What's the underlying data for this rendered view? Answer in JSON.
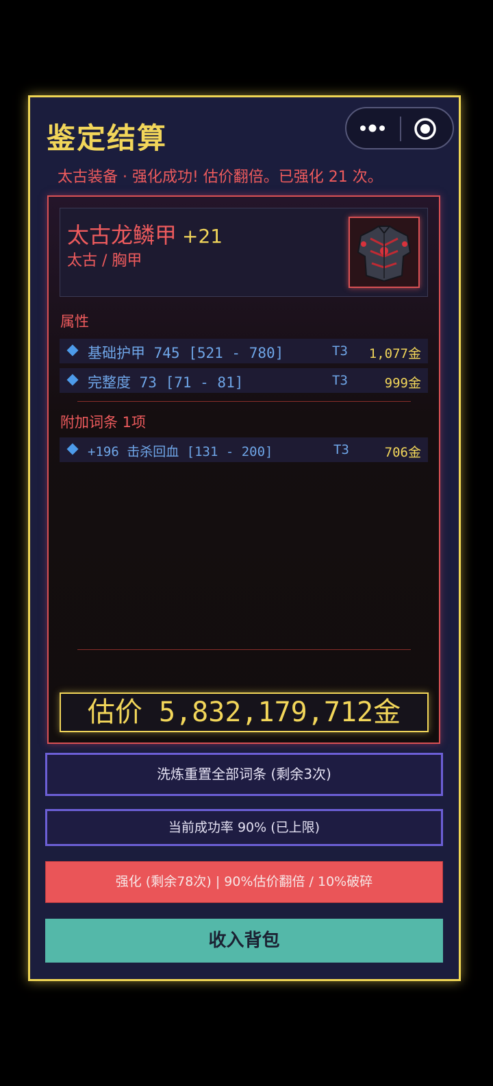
{
  "header": {
    "title": "鉴定结算",
    "subtitle": "太古装备 · 强化成功! 估价翻倍。已强化 21 次。"
  },
  "item": {
    "name": "太古龙鳞甲",
    "level": "+21",
    "type": "太古 / 胸甲",
    "icon": "armor-chestplate-icon"
  },
  "attributes": {
    "label": "属性",
    "rows": [
      {
        "stat": "基础护甲 745 [521 - 780]",
        "tier": "T3",
        "gold": "1,077金"
      },
      {
        "stat": "完整度 73 [71 - 81]",
        "tier": "T3",
        "gold": "999金"
      }
    ]
  },
  "affixes": {
    "label": "附加词条 1项",
    "rows": [
      {
        "stat": "+196 击杀回血 [131 - 200]",
        "tier": "T3",
        "gold": "706金"
      }
    ]
  },
  "price": "估价 5,832,179,712金",
  "buttons": {
    "reroll": "洗炼重置全部词条 (剩余3次)",
    "success_rate": "当前成功率 90% (已上限)",
    "enhance": "强化 (剩余78次) | 90%估价翻倍 / 10%破碎",
    "stash": "收入背包"
  },
  "colors": {
    "gold": "#f2d65a",
    "red": "#ee5b5d",
    "blue": "#6fa6e8",
    "purple": "#6c5fd6",
    "teal": "#54b8a9"
  }
}
